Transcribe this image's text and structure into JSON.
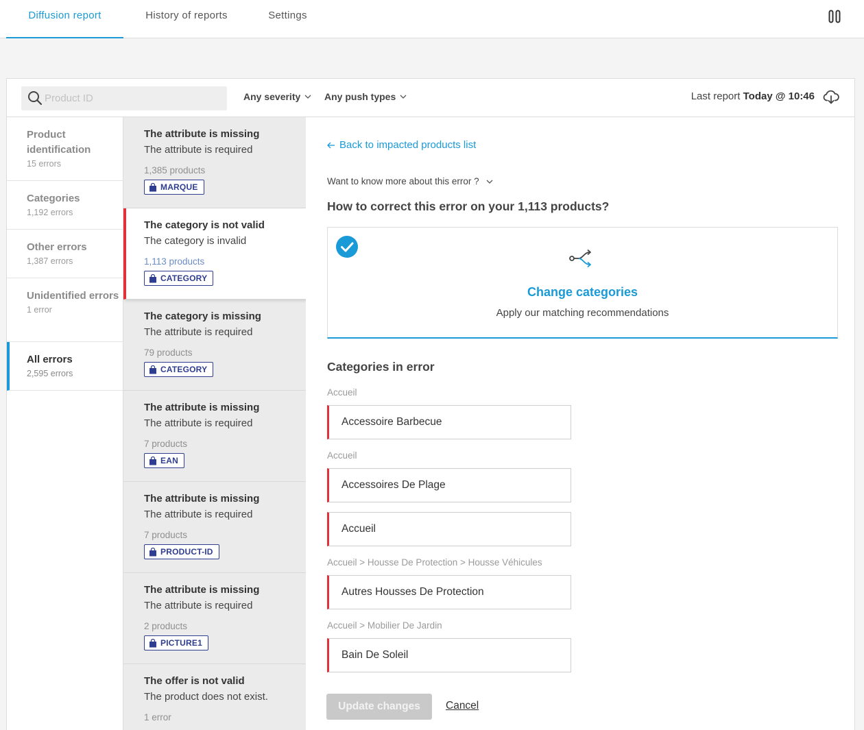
{
  "nav": {
    "tabs": [
      {
        "label": "Diffusion report",
        "active": true
      },
      {
        "label": "History of reports",
        "active": false
      },
      {
        "label": "Settings",
        "active": false
      }
    ],
    "pause_icon": "pause-icon"
  },
  "filters": {
    "search_placeholder": "Product ID",
    "severity_label": "Any severity",
    "push_types_label": "Any push types",
    "last_report_prefix": "Last report",
    "last_report_value": "Today @ 10:46",
    "download_icon": "cloud-download-icon"
  },
  "categories": [
    {
      "name": "Product identification",
      "count": "15 errors",
      "active": false
    },
    {
      "name": "Categories",
      "count": "1,192 errors",
      "active": false
    },
    {
      "name": "Other errors",
      "count": "1,387 errors",
      "active": false
    },
    {
      "name": "Unidentified errors",
      "count": "1 error",
      "active": false
    },
    {
      "name": "All errors",
      "count": "2,595 errors",
      "active": true
    }
  ],
  "errors": [
    {
      "title": "The attribute is missing",
      "desc": "The attribute is required",
      "products": "1,385 products",
      "badge": "MARQUE",
      "selected": false
    },
    {
      "title": "The category is not valid",
      "desc": "The category is invalid",
      "products": "1,113 products",
      "badge": "CATEGORY",
      "selected": true
    },
    {
      "title": "The category is missing",
      "desc": "The attribute is required",
      "products": "79 products",
      "badge": "CATEGORY",
      "selected": false
    },
    {
      "title": "The attribute is missing",
      "desc": "The attribute is required",
      "products": "7 products",
      "badge": "EAN",
      "selected": false
    },
    {
      "title": "The attribute is missing",
      "desc": "The attribute is required",
      "products": "7 products",
      "badge": "PRODUCT-ID",
      "selected": false
    },
    {
      "title": "The attribute is missing",
      "desc": "The attribute is required",
      "products": "2 products",
      "badge": "PICTURE1",
      "selected": false
    },
    {
      "title": "The offer is not valid",
      "desc": "The product does not exist.",
      "products": "1 error",
      "badge": "",
      "selected": false
    }
  ],
  "detail": {
    "back_link": "Back to impacted products list",
    "more_info": "Want to know more about this error ?",
    "how_title": "How to correct this error on your 1,113 products?",
    "option": {
      "title": "Change categories",
      "desc": "Apply our matching recommendations",
      "selected": true
    },
    "cats_title": "Categories in error",
    "category_rows": [
      {
        "crumb": "Accueil",
        "value": "Accessoire Barbecue"
      },
      {
        "crumb": "Accueil",
        "value": "Accessoires De Plage"
      },
      {
        "crumb": "",
        "value": "Accueil"
      },
      {
        "crumb": "Accueil > Housse De Protection > Housse Véhicules",
        "value": "Autres Housses De Protection"
      },
      {
        "crumb": "Accueil > Mobilier De Jardin",
        "value": "Bain De Soleil"
      }
    ],
    "update_label": "Update changes",
    "cancel_label": "Cancel"
  },
  "colors": {
    "accent": "#1a9ad6",
    "error": "#e0313b",
    "badge": "#2e3d8f"
  }
}
